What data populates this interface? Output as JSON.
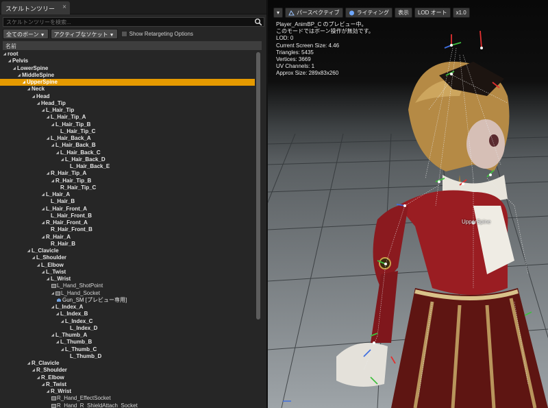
{
  "panel": {
    "tab_label": "スケルトンツリー",
    "close_glyph": "×",
    "search_placeholder": "スケルトンツリーを検索...",
    "filter_bones": "全てのボーン",
    "filter_sockets": "アクティブなソケット",
    "retarget_label": "Show Retargeting Options",
    "column_name": "名前",
    "tree": [
      {
        "label": "root",
        "depth": 0,
        "type": "bone"
      },
      {
        "label": "Pelvis",
        "depth": 1,
        "type": "bone"
      },
      {
        "label": "LowerSpine",
        "depth": 2,
        "type": "bone"
      },
      {
        "label": "MiddleSpine",
        "depth": 3,
        "type": "bone"
      },
      {
        "label": "UpperSpine",
        "depth": 4,
        "type": "bone",
        "selected": true
      },
      {
        "label": "Neck",
        "depth": 5,
        "type": "bone"
      },
      {
        "label": "Head",
        "depth": 6,
        "type": "bone"
      },
      {
        "label": "Head_Tip",
        "depth": 7,
        "type": "bone"
      },
      {
        "label": "L_Hair_Tip",
        "depth": 8,
        "type": "bone"
      },
      {
        "label": "L_Hair_Tip_A",
        "depth": 9,
        "type": "bone"
      },
      {
        "label": "L_Hair_Tip_B",
        "depth": 10,
        "type": "bone"
      },
      {
        "label": "L_Hair_Tip_C",
        "depth": 11,
        "type": "bone",
        "leaf": true
      },
      {
        "label": "L_Hair_Back_A",
        "depth": 9,
        "type": "bone"
      },
      {
        "label": "L_Hair_Back_B",
        "depth": 10,
        "type": "bone"
      },
      {
        "label": "L_Hair_Back_C",
        "depth": 11,
        "type": "bone"
      },
      {
        "label": "L_Hair_Back_D",
        "depth": 12,
        "type": "bone"
      },
      {
        "label": "L_Hair_Back_E",
        "depth": 13,
        "type": "bone",
        "leaf": true
      },
      {
        "label": "R_Hair_Tip_A",
        "depth": 9,
        "type": "bone"
      },
      {
        "label": "R_Hair_Tip_B",
        "depth": 10,
        "type": "bone"
      },
      {
        "label": "R_Hair_Tip_C",
        "depth": 11,
        "type": "bone",
        "leaf": true
      },
      {
        "label": "L_Hair_A",
        "depth": 8,
        "type": "bone"
      },
      {
        "label": "L_Hair_B",
        "depth": 9,
        "type": "bone",
        "leaf": true
      },
      {
        "label": "L_Hair_Front_A",
        "depth": 8,
        "type": "bone"
      },
      {
        "label": "L_Hair_Front_B",
        "depth": 9,
        "type": "bone",
        "leaf": true
      },
      {
        "label": "R_Hair_Front_A",
        "depth": 8,
        "type": "bone"
      },
      {
        "label": "R_Hair_Front_B",
        "depth": 9,
        "type": "bone",
        "leaf": true
      },
      {
        "label": "R_Hair_A",
        "depth": 8,
        "type": "bone"
      },
      {
        "label": "R_Hair_B",
        "depth": 9,
        "type": "bone",
        "leaf": true
      },
      {
        "label": "L_Clavicle",
        "depth": 5,
        "type": "bone"
      },
      {
        "label": "L_Shoulder",
        "depth": 6,
        "type": "bone"
      },
      {
        "label": "L_Elbow",
        "depth": 7,
        "type": "bone"
      },
      {
        "label": "L_Twist",
        "depth": 8,
        "type": "bone"
      },
      {
        "label": "L_Wrist",
        "depth": 9,
        "type": "bone"
      },
      {
        "label": "L_Hand_ShotPoint",
        "depth": 10,
        "type": "socket"
      },
      {
        "label": "L_Hand_Socket",
        "depth": 10,
        "type": "socket",
        "expanded": true
      },
      {
        "label": "Gun_SM [プレビュー専用]",
        "depth": 11,
        "type": "mesh"
      },
      {
        "label": "L_Index_A",
        "depth": 10,
        "type": "bone"
      },
      {
        "label": "L_Index_B",
        "depth": 11,
        "type": "bone"
      },
      {
        "label": "L_Index_C",
        "depth": 12,
        "type": "bone"
      },
      {
        "label": "L_Index_D",
        "depth": 13,
        "type": "bone",
        "leaf": true
      },
      {
        "label": "L_Thumb_A",
        "depth": 10,
        "type": "bone"
      },
      {
        "label": "L_Thumb_B",
        "depth": 11,
        "type": "bone"
      },
      {
        "label": "L_Thumb_C",
        "depth": 12,
        "type": "bone"
      },
      {
        "label": "L_Thumb_D",
        "depth": 13,
        "type": "bone",
        "leaf": true
      },
      {
        "label": "R_Clavicle",
        "depth": 5,
        "type": "bone"
      },
      {
        "label": "R_Shoulder",
        "depth": 6,
        "type": "bone"
      },
      {
        "label": "R_Elbow",
        "depth": 7,
        "type": "bone"
      },
      {
        "label": "R_Twist",
        "depth": 8,
        "type": "bone"
      },
      {
        "label": "R_Wrist",
        "depth": 9,
        "type": "bone"
      },
      {
        "label": "R_Hand_EffectSocket",
        "depth": 10,
        "type": "socket"
      },
      {
        "label": "R_Hand_R_ShieldAttach_Socket",
        "depth": 10,
        "type": "socket"
      }
    ]
  },
  "viewport": {
    "menu_glyph": "▾",
    "perspective": "パースペクティブ",
    "lighting": "ライティング",
    "show": "表示",
    "lod": "LOD オート",
    "speed": "x1.0",
    "info_lines": [
      "Player_AnimBP_C のプレビュー中。",
      "このモードではボーン操作が無効です。",
      "LOD: 0",
      "Current Screen Size: 4.46",
      "Triangles: 5435",
      "Vertices: 3669",
      "UV Channels: 1",
      "Approx Size: 289x83x260"
    ],
    "selected_bone_label": "UpperSpine"
  },
  "colors": {
    "selection": "#e59a00",
    "panel_bg": "#262626"
  }
}
